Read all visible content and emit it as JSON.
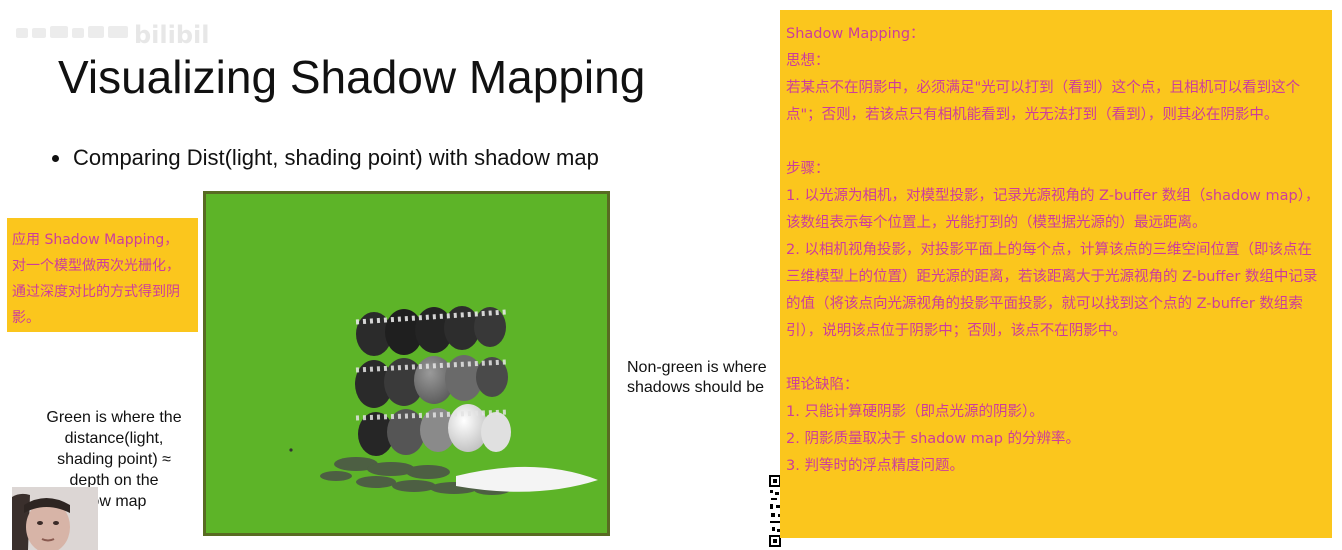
{
  "watermark": {
    "icon": "bilibili-logo-icon"
  },
  "slide": {
    "title": "Visualizing Shadow Mapping",
    "bullet": "Comparing Dist(light, shading point) with shadow map",
    "caption_right": "Non-green is where\nshadows should be",
    "caption_left": "Green is where the\ndistance(light,\nshading point) ≈\ndepth on the\n     dow map",
    "render_colors": {
      "background": "#5db428",
      "border": "#586b22"
    }
  },
  "note_left": {
    "text": "应用 Shadow Mapping，对一个模型做两次光栅化，通过深度对比的方式得到阴影。"
  },
  "note_right": {
    "heading": "Shadow Mapping：",
    "idea_label": "思想：",
    "idea_text": "若某点不在阴影中，必须满足\"光可以打到（看到）这个点，且相机可以看到这个点\"；否则，若该点只有相机能看到，光无法打到（看到），则其必在阴影中。",
    "steps_label": "步骤：",
    "step1": "1. 以光源为相机，对模型投影，记录光源视角的 Z-buffer 数组（shadow map），该数组表示每个位置上，光能打到的（模型据光源的）最远距离。",
    "step2": "2. 以相机视角投影，对投影平面上的每个点，计算该点的三维空间位置（即该点在三维模型上的位置）距光源的距离，若该距离大于光源视角的 Z-buffer 数组中记录的值（将该点向光源视角的投影平面投影，就可以找到这个点的 Z-buffer 数组索引），说明该点位于阴影中；否则，该点不在阴影中。",
    "defects_label": "理论缺陷：",
    "defect1": "1. 只能计算硬阴影（即点光源的阴影）。",
    "defect2": "2. 阴影质量取决于 shadow map 的分辨率。",
    "defect3": "3. 判等时的浮点精度问题。"
  },
  "colors": {
    "note_bg": "#fbc61d",
    "note_text": "#cc3d9c"
  }
}
